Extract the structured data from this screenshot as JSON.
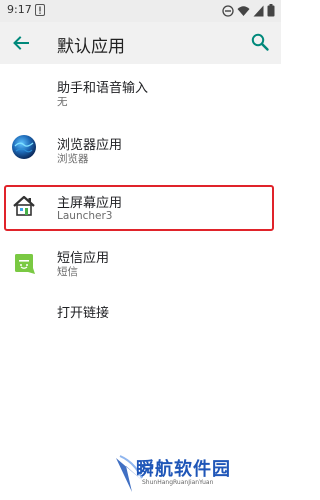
{
  "status_bar": {
    "time": "9:17",
    "alert_icon": "alert-icon",
    "icons": [
      "do-not-disturb-icon",
      "wifi-icon",
      "signal-icon",
      "battery-icon"
    ]
  },
  "app_bar": {
    "title": "默认应用",
    "back_icon": "arrow-back-icon",
    "search_icon": "search-icon"
  },
  "items": [
    {
      "title": "助手和语音输入",
      "subtitle": "无"
    },
    {
      "title": "浏览器应用",
      "subtitle": "浏览器",
      "icon": "browser-globe-icon"
    },
    {
      "title": "主屏幕应用",
      "subtitle": "Launcher3",
      "icon": "home-icon",
      "highlighted": true
    },
    {
      "title": "短信应用",
      "subtitle": "短信",
      "icon": "sms-icon"
    },
    {
      "title": "打开链接"
    }
  ],
  "watermark": {
    "text": "瞬航软件园",
    "subtext": "ShunHangRuanJianYuan"
  },
  "colors": {
    "accent": "#00897b",
    "highlight_border": "#e0232a",
    "watermark": "#1f56b8"
  }
}
